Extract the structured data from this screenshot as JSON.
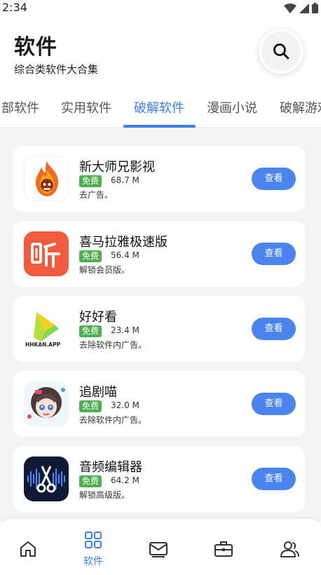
{
  "status": {
    "time": "2:34"
  },
  "header": {
    "title": "软件",
    "subtitle": "综合类软件大合集"
  },
  "tabs": [
    {
      "label": "部软件"
    },
    {
      "label": "实用软件"
    },
    {
      "label": "破解软件"
    },
    {
      "label": "漫画小说"
    },
    {
      "label": "破解游戏"
    }
  ],
  "apps": [
    {
      "name": "新大师兄影视",
      "badge": "免费",
      "size": "68.7 M",
      "desc": "去广告。",
      "button": "查看"
    },
    {
      "name": "喜马拉雅极速版",
      "badge": "免费",
      "size": "56.4 M",
      "desc": "解锁会员版。",
      "button": "查看"
    },
    {
      "name": "好好看",
      "badge": "免费",
      "size": "23.4 M",
      "desc": "去除软件内广告。",
      "button": "查看",
      "icon_text": "HHKAN.APP"
    },
    {
      "name": "追剧喵",
      "badge": "免费",
      "size": "32.0 M",
      "desc": "去除软件内广告。",
      "button": "查看"
    },
    {
      "name": "音频编辑器",
      "badge": "免费",
      "size": "64.2 M",
      "desc": "解锁高级版。",
      "button": "查看"
    }
  ],
  "nav": {
    "active_label": "软件"
  },
  "colors": {
    "accent": "#3d7ff0",
    "badge": "#4caf50",
    "button": "#4a84ef",
    "ximalaya": "#f25a3e"
  }
}
